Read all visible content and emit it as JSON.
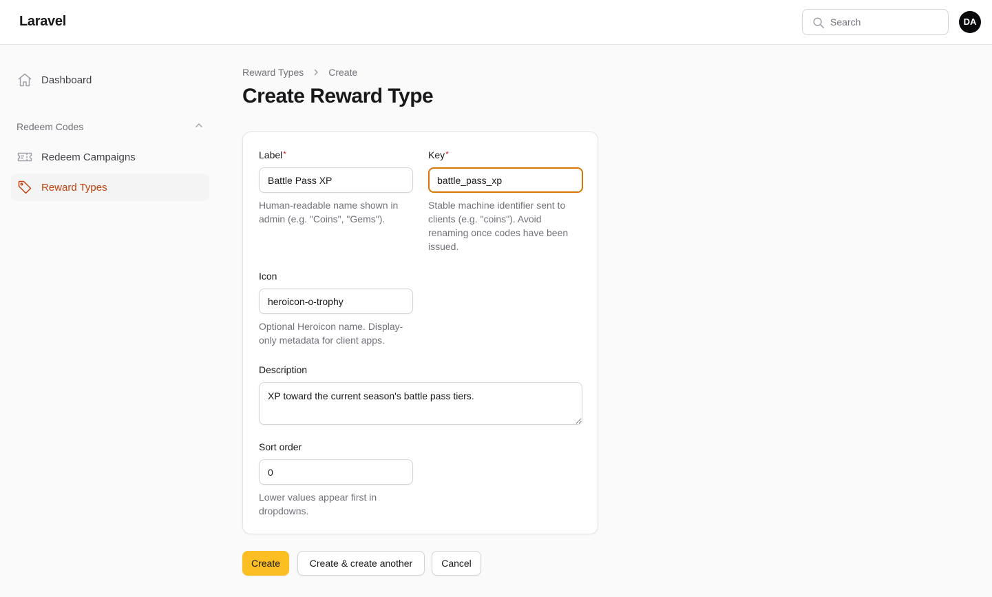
{
  "app": {
    "brand": "Laravel"
  },
  "search": {
    "placeholder": "Search",
    "value": ""
  },
  "user": {
    "initials": "DA"
  },
  "sidebar": {
    "dashboard": {
      "label": "Dashboard",
      "icon": "home-icon"
    },
    "group": {
      "label": "Redeem Codes",
      "icon": "chevron-up-icon"
    },
    "items": [
      {
        "label": "Redeem Campaigns",
        "icon": "ticket-icon",
        "active": false
      },
      {
        "label": "Reward Types",
        "icon": "tag-icon",
        "active": true
      }
    ]
  },
  "breadcrumb": {
    "items": [
      "Reward Types",
      "Create"
    ]
  },
  "page": {
    "title": "Create Reward Type"
  },
  "form": {
    "label": {
      "label": "Label",
      "required": "*",
      "value": "Battle Pass XP",
      "hint": "Human-readable name shown in admin (e.g. \"Coins\", \"Gems\")."
    },
    "key": {
      "label": "Key",
      "required": "*",
      "value": "battle_pass_xp",
      "hint": "Stable machine identifier sent to clients (e.g. \"coins\"). Avoid renaming once codes have been issued."
    },
    "icon": {
      "label": "Icon",
      "value": "heroicon-o-trophy",
      "hint": "Optional Heroicon name. Display-only metadata for client apps."
    },
    "description": {
      "label": "Description",
      "value": "XP toward the current season's battle pass tiers."
    },
    "sort_order": {
      "label": "Sort order",
      "value": "0",
      "hint": "Lower values appear first in dropdowns."
    }
  },
  "actions": {
    "create": "Create",
    "create_another": "Create & create another",
    "cancel": "Cancel"
  },
  "colors": {
    "accent": "#c2410c",
    "primary_button": "#fbbf24",
    "focus_ring": "#d97706",
    "required": "#dc2626"
  }
}
